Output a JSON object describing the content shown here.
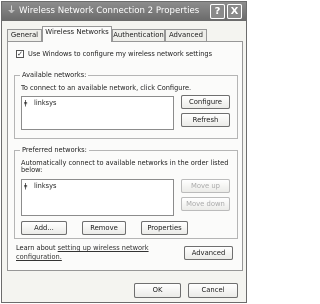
{
  "window": {
    "title": "Wireless Network Connection 2 Properties",
    "help_label": "?",
    "close_label": "X",
    "icon": "network-connection-icon"
  },
  "tabs": [
    {
      "label": "General"
    },
    {
      "label": "Wireless Networks"
    },
    {
      "label": "Authentication"
    },
    {
      "label": "Advanced"
    }
  ],
  "wireless": {
    "use_windows_label": "Use Windows to configure my wireless network settings",
    "use_windows_checked": true,
    "available": {
      "group_title": "Available networks:",
      "instruction": "To connect to an available network, click Configure.",
      "networks": [
        {
          "name": "linksys",
          "icon": "wireless-antenna-icon"
        }
      ],
      "configure_label": "Configure",
      "refresh_label": "Refresh"
    },
    "preferred": {
      "group_title": "Preferred networks:",
      "instruction_line1": "Automatically connect to available networks in the order listed",
      "instruction_line2": "below:",
      "networks": [
        {
          "name": "linksys",
          "icon": "wireless-antenna-icon"
        }
      ],
      "move_up_label": "Move up",
      "move_down_label": "Move down",
      "add_label": "Add...",
      "remove_label": "Remove",
      "properties_label": "Properties"
    },
    "learn": {
      "prefix": "Learn about ",
      "link_line1": "setting up wireless network",
      "link_line2": "configuration."
    },
    "advanced_label": "Advanced"
  },
  "footer": {
    "ok_label": "OK",
    "cancel_label": "Cancel"
  }
}
